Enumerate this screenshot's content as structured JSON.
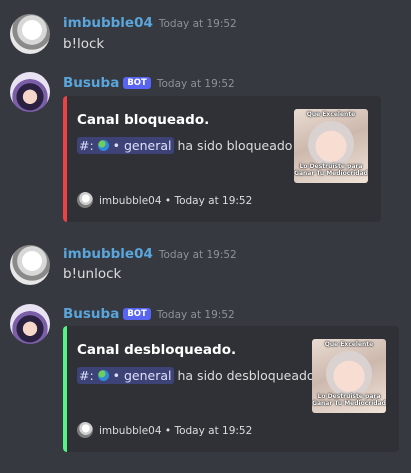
{
  "messages": [
    {
      "author": "imbubble04",
      "timestamp": "Today at 19:52",
      "text": "b!lock"
    },
    {
      "author": "Busuba",
      "badge": "BOT",
      "timestamp": "Today at 19:52",
      "embed": {
        "title": "Canal bloqueado.",
        "channel_hash": "#:",
        "channel_name": "• general",
        "desc_suffix": "ha sido bloqueado",
        "color": "#ed4245",
        "thumb_top": "Que Excelente",
        "thumb_bottom": "Lo Destruiste para Ganar\nTu Mediocridad",
        "footer_author": "imbubble04",
        "footer_sep": "•",
        "footer_time": "Today at 19:52"
      }
    },
    {
      "author": "imbubble04",
      "timestamp": "Today at 19:52",
      "text": "b!unlock"
    },
    {
      "author": "Busuba",
      "badge": "BOT",
      "timestamp": "Today at 19:52",
      "embed": {
        "title": "Canal desbloqueado.",
        "channel_hash": "#:",
        "channel_name": "• general",
        "desc_suffix": "ha sido desbloqueado",
        "color": "#57f287",
        "thumb_top": "Que Excelente",
        "thumb_bottom": "Lo Destruiste para Ganar\nTu Mediocridad",
        "footer_author": "imbubble04",
        "footer_sep": "•",
        "footer_time": "Today at 19:52"
      }
    }
  ]
}
